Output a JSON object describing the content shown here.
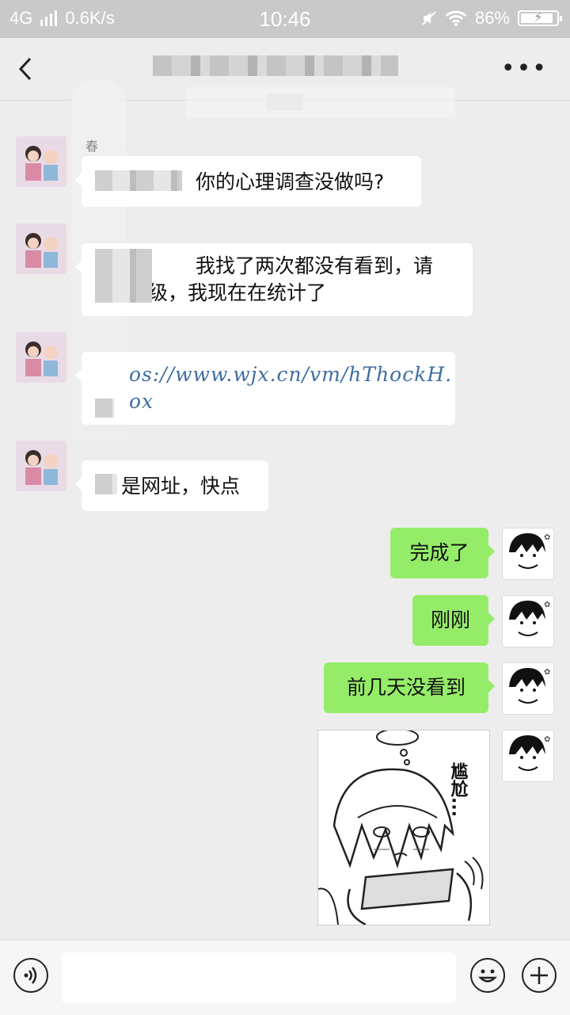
{
  "status_bar": {
    "network": "4G",
    "speed": "0.6K/s",
    "time": "10:46",
    "battery": "86%"
  },
  "chat": {
    "sender_name": "春",
    "messages": [
      {
        "side": "in",
        "text": "你的心理调查没做吗?"
      },
      {
        "side": "in",
        "text_line1": "我找了两次都没有看到，请",
        "text_line2": "级，我现在在统计了"
      },
      {
        "side": "in",
        "text_line1": "os://www.wjx.cn/vm/hThockH.",
        "text_line2": "ox"
      },
      {
        "side": "in",
        "text": "是网址，快点"
      },
      {
        "side": "out",
        "text": "完成了"
      },
      {
        "side": "out",
        "text": "刚刚"
      },
      {
        "side": "out",
        "text": "前几天没看到"
      },
      {
        "side": "out",
        "type": "sticker",
        "caption": "尴尬..."
      }
    ]
  },
  "icons": {
    "back": "chevron-left-icon",
    "more": "more-icon",
    "voice": "voice-icon",
    "emoji": "emoji-icon",
    "plus": "plus-icon"
  },
  "colors": {
    "outgoing_bubble": "#95ec69",
    "incoming_bubble": "#ffffff",
    "background": "#ededed",
    "link": "#3e6ea3"
  }
}
